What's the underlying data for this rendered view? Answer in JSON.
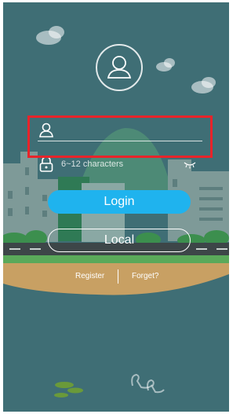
{
  "login_form": {
    "username_placeholder": "",
    "password_placeholder": "6~12 characters"
  },
  "buttons": {
    "login_label": "Login",
    "local_label": "Local"
  },
  "links": {
    "register_label": "Register",
    "forget_label": "Forget?"
  },
  "colors": {
    "background": "#3f6e75",
    "login_button": "#1fb3ee",
    "highlight": "#e8242a"
  },
  "icons": [
    "avatar-icon",
    "user-icon",
    "lock-icon",
    "eye-closed-icon"
  ]
}
